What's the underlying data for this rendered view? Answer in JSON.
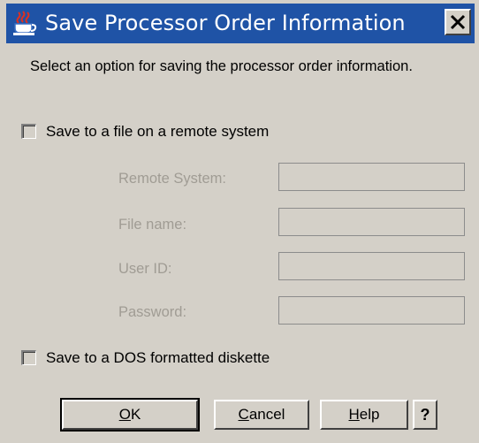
{
  "window": {
    "title": "Save Processor Order Information",
    "close_symbol": "X"
  },
  "description": "Select an option for saving the processor order information.",
  "options": {
    "remote": {
      "label": "Save to a file on a remote system",
      "checked": false
    },
    "diskette": {
      "label": "Save to a DOS formatted diskette",
      "checked": false
    }
  },
  "remote_fields": {
    "remote_system": {
      "label": "Remote System:",
      "value": ""
    },
    "file_name": {
      "label": "File name:",
      "value": ""
    },
    "user_id": {
      "label": "User ID:",
      "value": ""
    },
    "password": {
      "label": "Password:",
      "value": ""
    }
  },
  "buttons": {
    "ok": {
      "mnemonic": "O",
      "rest": "K"
    },
    "cancel": {
      "mnemonic": "C",
      "rest": "ancel"
    },
    "help": {
      "mnemonic": "H",
      "rest": "elp"
    },
    "context_help": "?"
  },
  "colors": {
    "title_bar": "#1f53a6",
    "dialog_bg": "#d4d0c8",
    "disabled_text": "#a09c94"
  },
  "icons": {
    "app": "java-cup-icon",
    "close": "close-icon"
  }
}
